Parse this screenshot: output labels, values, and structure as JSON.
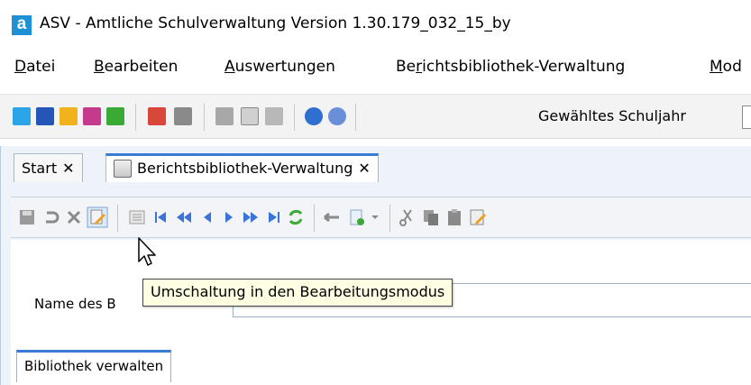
{
  "window": {
    "app_icon_letter": "a",
    "title": "ASV - Amtliche Schulverwaltung Version 1.30.179_032_15_by"
  },
  "menu": {
    "items": [
      {
        "label": "Datei",
        "accel": "D"
      },
      {
        "label": "Bearbeiten",
        "accel": "B"
      },
      {
        "label": "Auswertungen",
        "accel": "A"
      },
      {
        "label": "Berichtsbibliothek-Verwaltung",
        "accel": "r"
      },
      {
        "label": "Mod",
        "accel": "M"
      }
    ]
  },
  "toolbar": {
    "year_label": "Gewähltes Schuljahr",
    "icons": [
      "people-icon",
      "card-icon",
      "group-icon",
      "monitor-icon",
      "display-icon",
      "book-icon",
      "report-icon",
      "gears-icon",
      "window-icon",
      "lightning-icon",
      "info-icon",
      "help-icon"
    ]
  },
  "tabs": [
    {
      "label": "Start",
      "close": "✕"
    },
    {
      "label": "Berichtsbibliothek-Verwaltung",
      "close": "✕"
    }
  ],
  "inner_toolbar": {
    "icons": [
      "save-icon",
      "undo-icon",
      "delete-icon",
      "edit-mode-icon",
      "list-icon",
      "first-icon",
      "prev-page-icon",
      "prev-icon",
      "next-icon",
      "next-page-icon",
      "last-icon",
      "refresh-icon",
      "back-arrow-icon",
      "new-document-icon",
      "dropdown-icon",
      "cut-icon",
      "copy-icon",
      "paste-icon",
      "edit-icon"
    ]
  },
  "form": {
    "name_label": "Name des B",
    "name_value": ""
  },
  "subtab": {
    "label": "Bibliothek verwalten"
  },
  "tooltip": {
    "text": "Umschaltung in den Bearbeitungsmodus"
  },
  "colors": {
    "accent": "#3a7bd5",
    "app_icon": "#1e90d6",
    "tooltip_bg": "#fffee3"
  }
}
